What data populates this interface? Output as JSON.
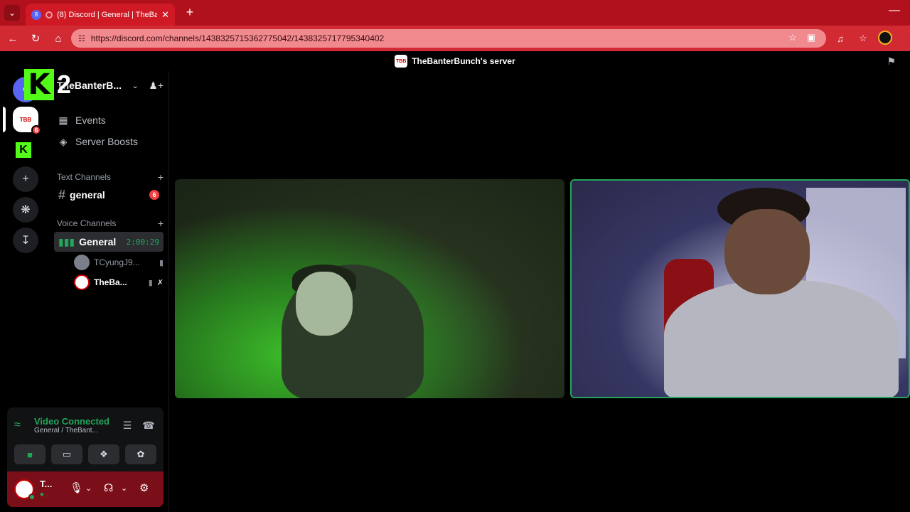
{
  "browser": {
    "tab_title": "(8) Discord | General | TheBanterBunch",
    "tab_favicon_badge": "8",
    "url": "https://discord.com/channels/1438325715362775042/1438325717795340402"
  },
  "discord": {
    "server_title": "TheBanterBunch's server",
    "server_header": "TheBanterB...",
    "overlay_number": "2",
    "rail_badge": "6",
    "sidebar": {
      "events": "Events",
      "server_boosts": "Server Boosts",
      "text_category": "Text Channels",
      "text_channel": "general",
      "text_channel_badge": "6",
      "voice_category": "Voice Channels",
      "voice_channel": "General",
      "voice_timer": "2:00:29",
      "voice_users": [
        {
          "name": "TCyungJ9..."
        },
        {
          "name": "TheBa..."
        }
      ]
    },
    "voice_panel": {
      "status": "Video Connected",
      "sub": "General / TheBant..."
    },
    "user_panel": {
      "name": "T...",
      "sub": "● ."
    }
  }
}
